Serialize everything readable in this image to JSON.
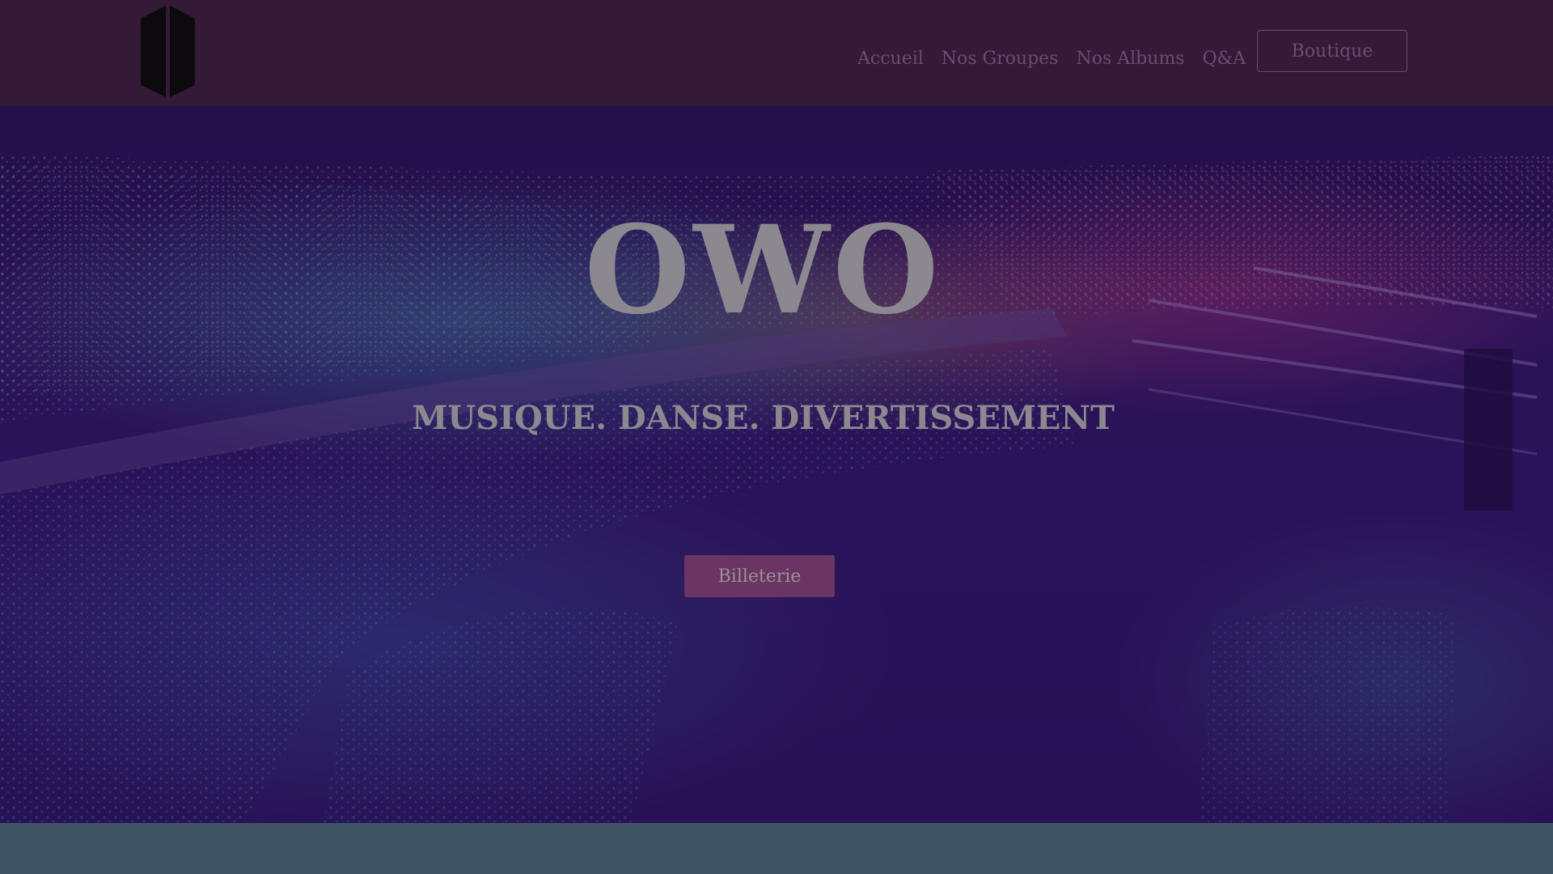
{
  "header": {
    "logo_icon": "vertical-doors-logo-icon",
    "nav": [
      {
        "label": "Accueil"
      },
      {
        "label": "Nos Groupes"
      },
      {
        "label": "Nos Albums"
      },
      {
        "label": "Q&A"
      }
    ],
    "shop_label": "Boutique"
  },
  "hero": {
    "title": "OWO",
    "subtitle": "MUSIQUE. DANSE. DIVERTISSEMENT",
    "ticket_label": "Billeterie",
    "background_image": "concert-stadium-lightsticks-photo"
  },
  "colors": {
    "header_bg": "#341a37",
    "nav_text": "#6e4a74",
    "button_bg": "#6a3563",
    "footer_bg": "#3f5566",
    "hero_text": "#8c8890"
  }
}
